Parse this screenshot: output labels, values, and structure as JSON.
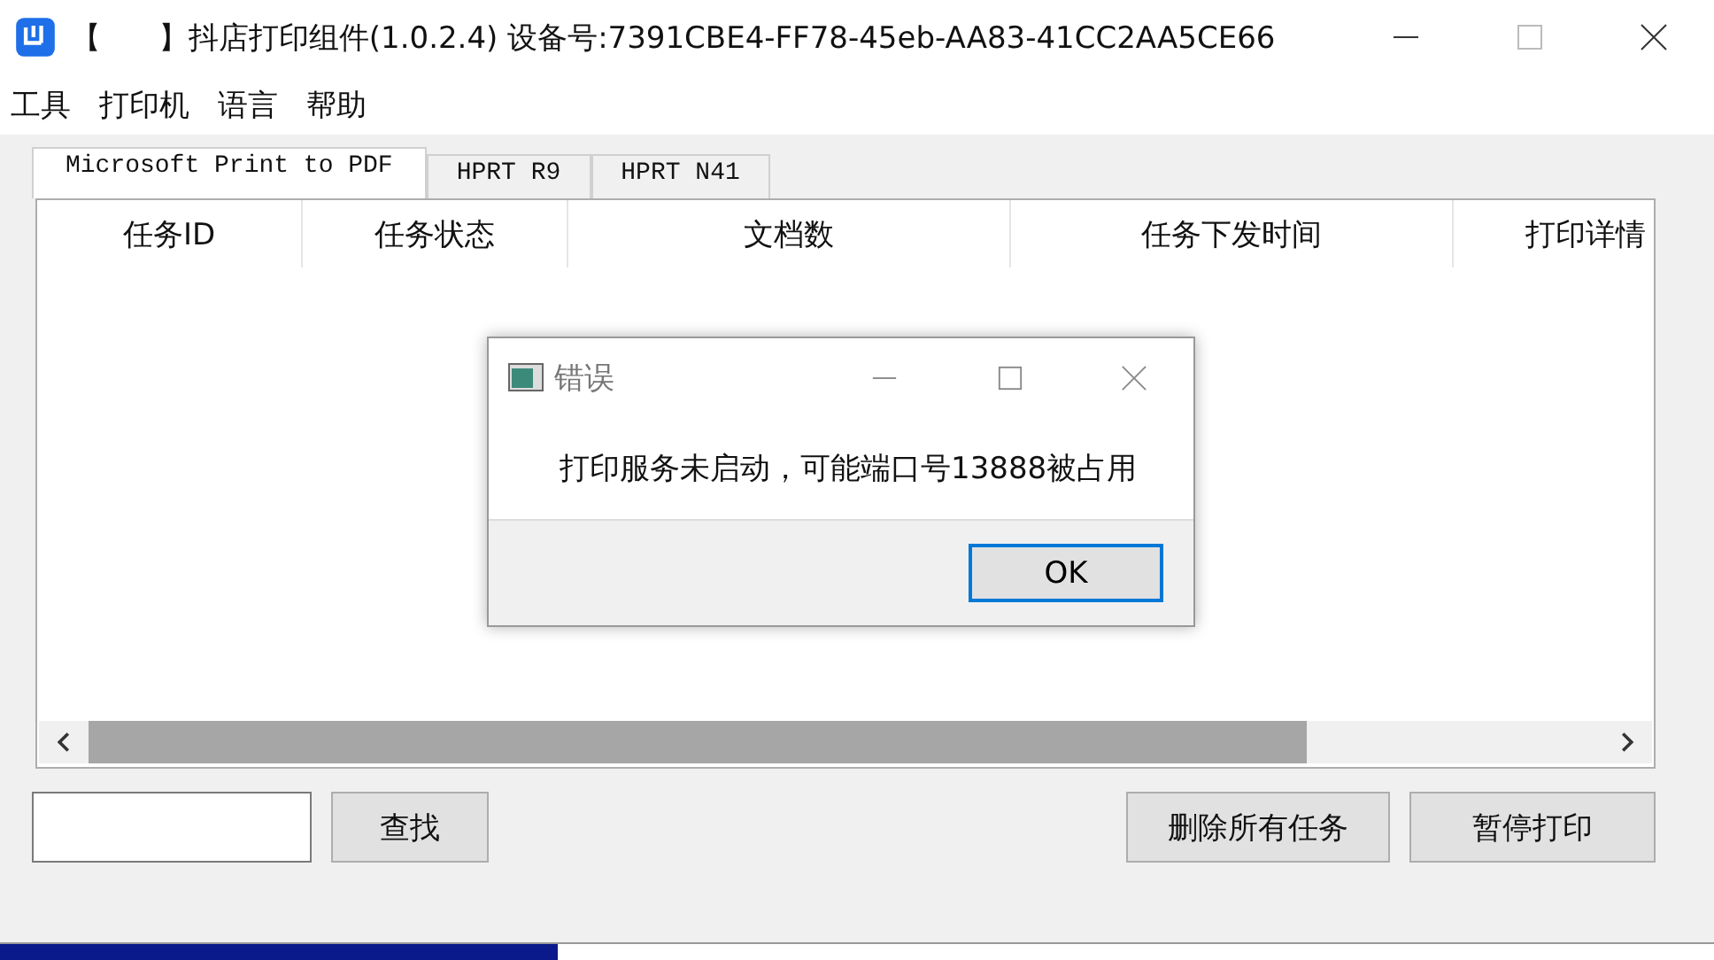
{
  "window": {
    "title": "【      】抖店打印组件(1.0.2.4) 设备号:7391CBE4-FF78-45eb-AA83-41CC2AA5CE66"
  },
  "menu": [
    "工具",
    "打印机",
    "语言",
    "帮助"
  ],
  "tabs": [
    {
      "label": "Microsoft Print to PDF",
      "selected": true
    },
    {
      "label": "HPRT R9",
      "selected": false
    },
    {
      "label": "HPRT N41",
      "selected": false
    }
  ],
  "table": {
    "columns": [
      "任务ID",
      "任务状态",
      "文档数",
      "任务下发时间",
      "打印详情"
    ]
  },
  "search": {
    "button": "查找"
  },
  "actions": [
    "删除所有任务",
    "暂停打印"
  ],
  "dialog": {
    "title": "错误",
    "message": "打印服务未启动，可能端口号13888被占用",
    "button": "OK"
  }
}
